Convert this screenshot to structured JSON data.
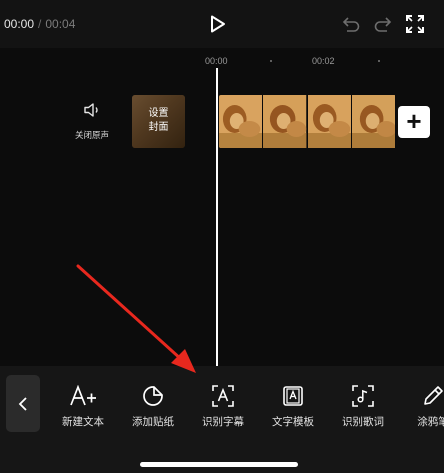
{
  "playback": {
    "current_time": "00:00",
    "separator": "/",
    "total_time": "00:04"
  },
  "timeline": {
    "ticks": [
      "00:00",
      "00:02"
    ],
    "mute_label": "关闭原声",
    "cover_label": "设置封面",
    "add_label": "+"
  },
  "toolbar": {
    "items": [
      {
        "label": "新建文本",
        "icon": "text-add-icon"
      },
      {
        "label": "添加贴纸",
        "icon": "sticker-icon"
      },
      {
        "label": "识别字幕",
        "icon": "subtitle-recognize-icon"
      },
      {
        "label": "文字模板",
        "icon": "text-template-icon"
      },
      {
        "label": "识别歌词",
        "icon": "lyrics-recognize-icon"
      },
      {
        "label": "涂鸦笔",
        "icon": "brush-icon"
      }
    ]
  },
  "colors": {
    "annotation_arrow": "#e8281e",
    "background": "#000000",
    "toolbar": "#161616"
  }
}
